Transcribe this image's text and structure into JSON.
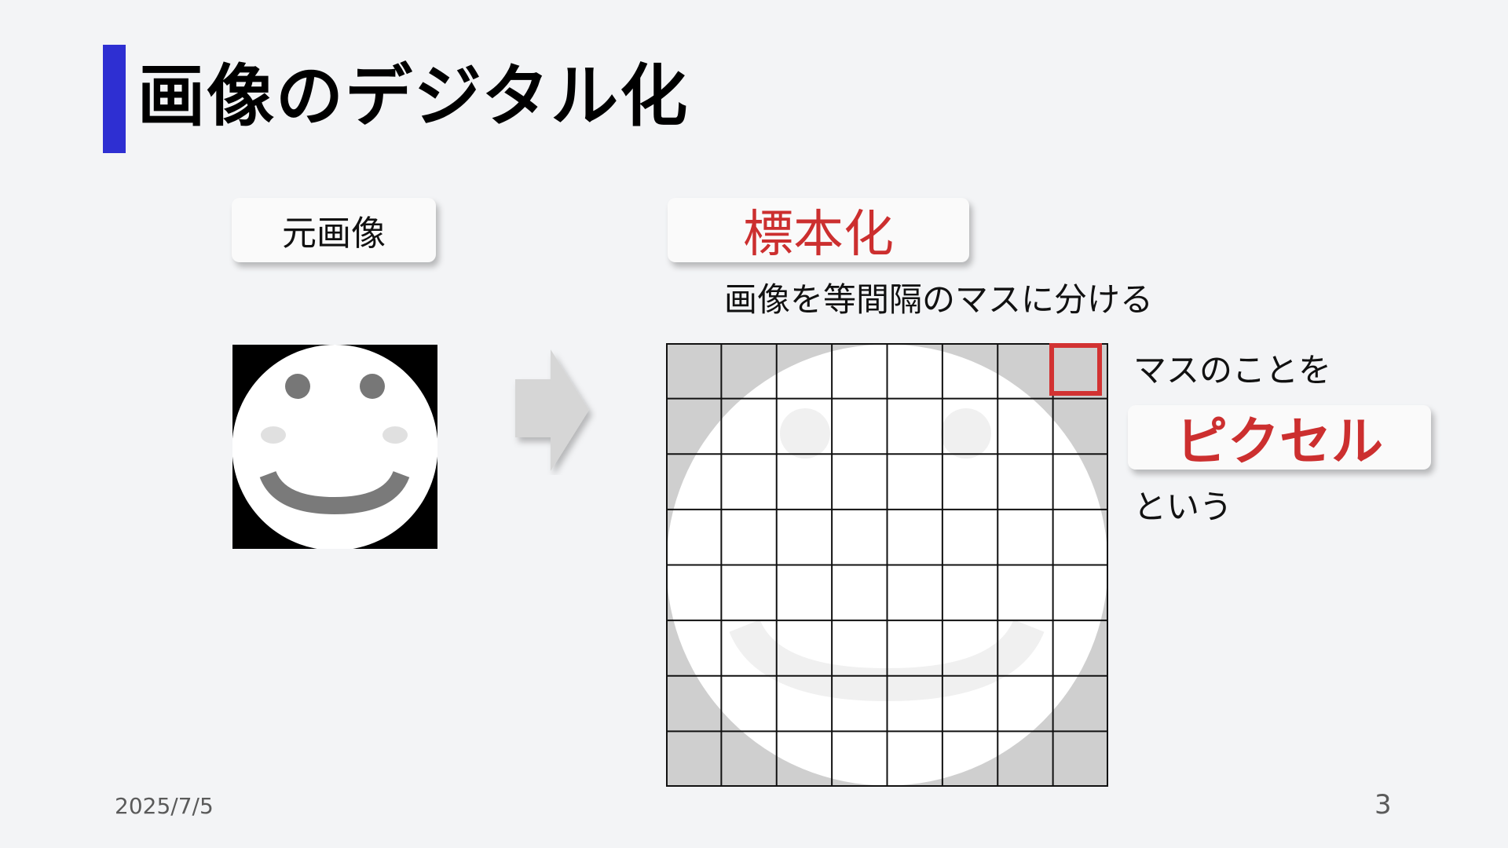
{
  "slide": {
    "title": "画像のデジタル化",
    "accent_color": "#2e2fd2",
    "highlight_color": "#cc2f2f"
  },
  "labels": {
    "original": "元画像",
    "sampling": "標本化",
    "sampling_desc": "画像を等間隔のマスに分ける",
    "pixel_prefix": "マスのことを",
    "pixel": "ピクセル",
    "pixel_suffix": "という"
  },
  "grid": {
    "rows": 8,
    "cols": 8
  },
  "footer": {
    "date": "2025/7/5",
    "page": "3"
  }
}
